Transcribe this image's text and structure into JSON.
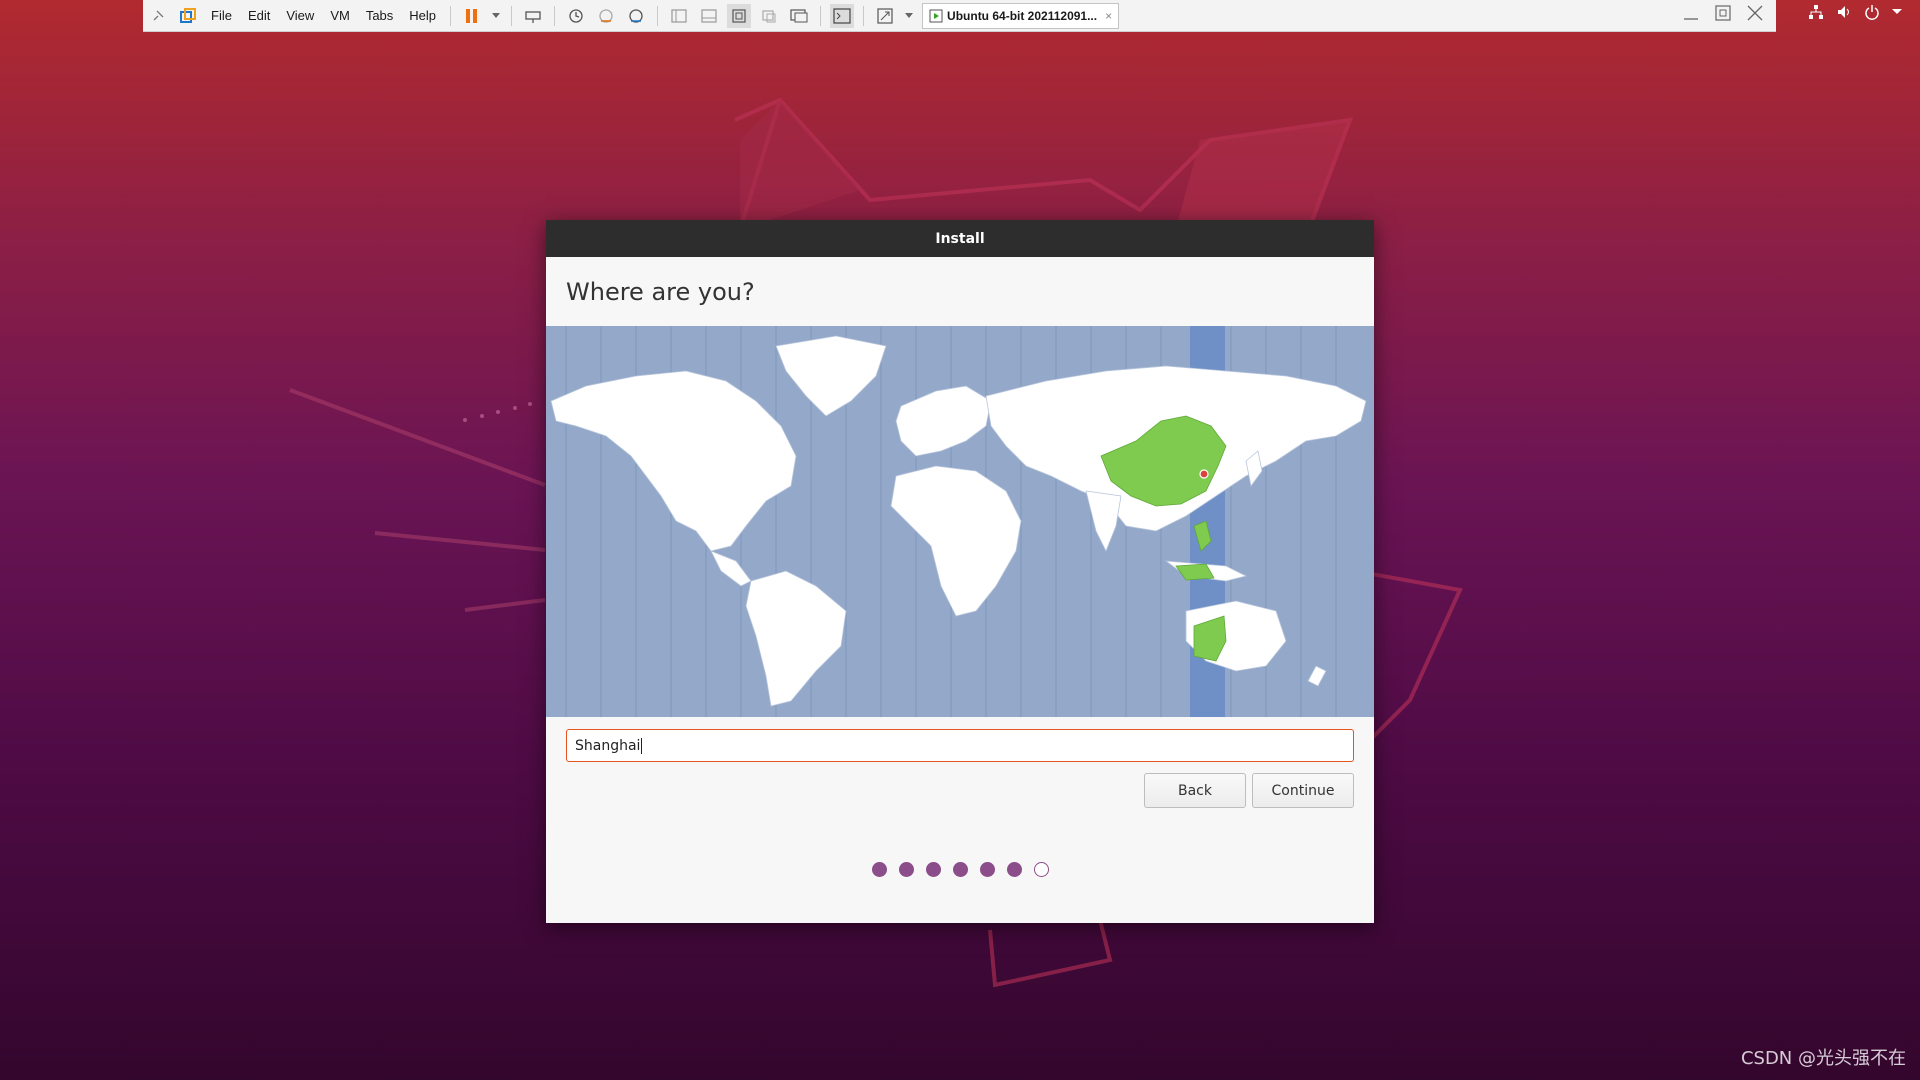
{
  "vmware": {
    "menus": [
      "File",
      "Edit",
      "View",
      "VM",
      "Tabs",
      "Help"
    ],
    "tab_title": "Ubuntu 64-bit 202112091...",
    "tab_close": "×"
  },
  "installer": {
    "window_title": "Install",
    "heading": "Where are you?",
    "timezone_value": "Shanghai",
    "back_label": "Back",
    "continue_label": "Continue",
    "progress": {
      "total_steps": 7,
      "completed_steps": 6
    }
  },
  "watermark": "CSDN @光头强不在",
  "colors": {
    "ubuntu_orange": "#e95420",
    "map_ocean": "#94a8c9",
    "selected_country": "#7fcb4f",
    "timezone_band": "#6f8fc7",
    "progress_dot": "#8c4d8b"
  }
}
